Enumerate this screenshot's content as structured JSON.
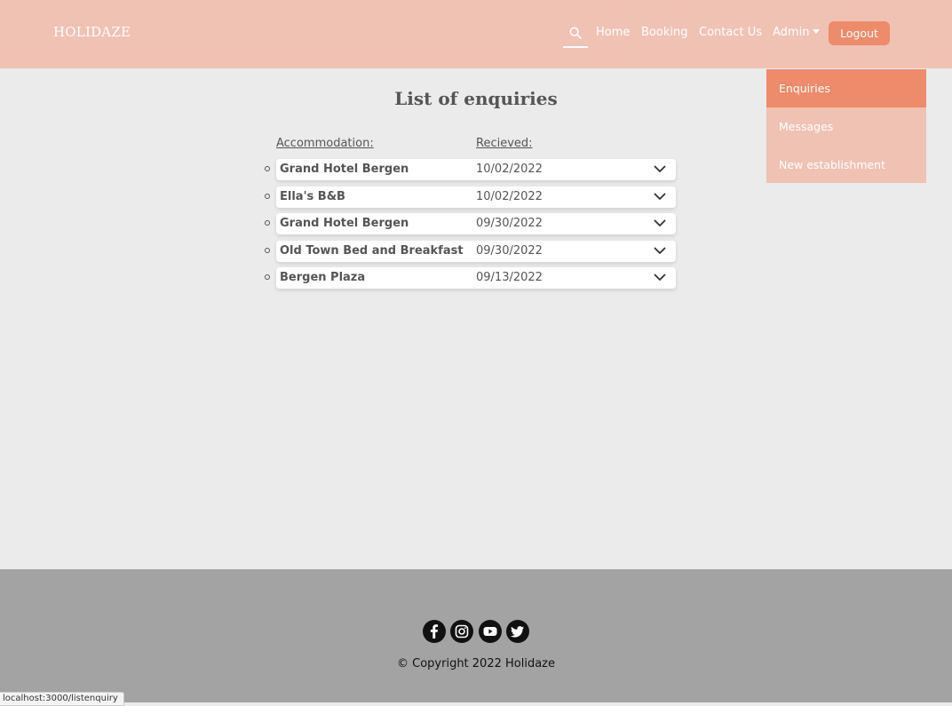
{
  "header": {
    "logo": "HOLIDAZE",
    "nav": {
      "home": "Home",
      "booking": "Booking",
      "contact": "Contact Us",
      "admin": "Admin"
    },
    "logout": "Logout",
    "search_icon": "search-icon"
  },
  "admin_menu": {
    "items": [
      "Enquiries",
      "Messages",
      "New establishment"
    ],
    "active": "Enquiries"
  },
  "main": {
    "title": "List of enquiries",
    "columns": {
      "accommodation": "Accommodation:",
      "received": "Recieved:"
    },
    "rows": [
      {
        "name": "Grand Hotel Bergen",
        "date": "10/02/2022"
      },
      {
        "name": "Ella's B&B",
        "date": "10/02/2022"
      },
      {
        "name": "Grand Hotel Bergen",
        "date": "09/30/2022"
      },
      {
        "name": "Old Town Bed and Breakfast",
        "date": "09/30/2022"
      },
      {
        "name": "Bergen Plaza",
        "date": "09/13/2022"
      }
    ]
  },
  "footer": {
    "social": [
      "facebook-icon",
      "instagram-icon",
      "youtube-icon",
      "twitter-icon"
    ],
    "copyright": "© Copyright 2022 Holidaze"
  },
  "status_bar": {
    "url": "localhost:3000/listenquiry"
  },
  "colors": {
    "header_bg": "#efc2b4",
    "accent": "#ed8b6a",
    "page_bg": "#ebebeb",
    "footer_bg": "#a3a3a3"
  }
}
